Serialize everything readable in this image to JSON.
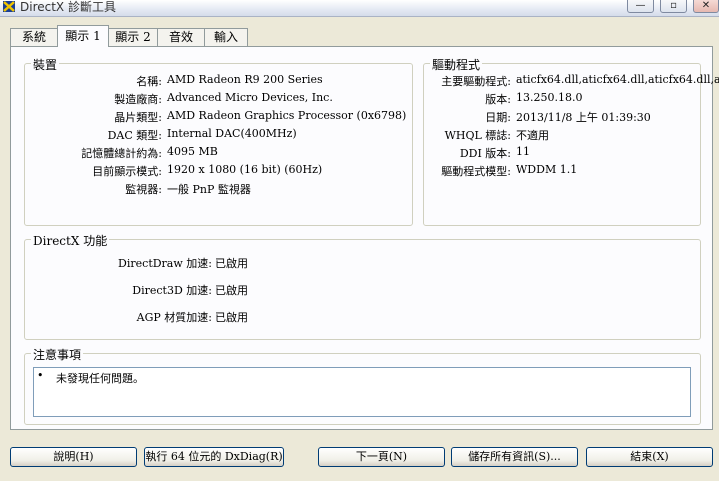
{
  "window": {
    "title": "DirectX 診斷工具",
    "minimize": "—",
    "maximize": "▫",
    "close": "✕"
  },
  "tabs": [
    {
      "label": "系統"
    },
    {
      "label": "顯示 1"
    },
    {
      "label": "顯示 2"
    },
    {
      "label": "音效"
    },
    {
      "label": "輸入"
    }
  ],
  "device": {
    "title": "裝置",
    "rows": [
      {
        "label": "名稱:",
        "value": "AMD Radeon R9 200 Series"
      },
      {
        "label": "製造廠商:",
        "value": "Advanced Micro Devices, Inc."
      },
      {
        "label": "晶片類型:",
        "value": "AMD Radeon Graphics Processor (0x6798)"
      },
      {
        "label": "DAC 類型:",
        "value": "Internal DAC(400MHz)"
      },
      {
        "label": "記憶體總計約為:",
        "value": "4095 MB"
      },
      {
        "label": "目前顯示模式:",
        "value": "1920 x 1080 (16 bit) (60Hz)"
      },
      {
        "label": "監視器:",
        "value": "一般 PnP 監視器"
      }
    ]
  },
  "driver": {
    "title": "驅動程式",
    "rows": [
      {
        "label": "主要驅動程式:",
        "value": "aticfx64.dll,aticfx64.dll,aticfx64.dll,at"
      },
      {
        "label": "版本:",
        "value": "13.250.18.0"
      },
      {
        "label": "日期:",
        "value": "2013/11/8 上午 01:39:30"
      },
      {
        "label": "WHQL 標誌:",
        "value": "不適用"
      },
      {
        "label": "DDI 版本:",
        "value": "11"
      },
      {
        "label": "驅動程式模型:",
        "value": "WDDM 1.1"
      }
    ]
  },
  "features": {
    "title": "DirectX 功能",
    "rows": [
      {
        "label": "DirectDraw 加速:",
        "value": "已啟用"
      },
      {
        "label": "Direct3D 加速:",
        "value": "已啟用"
      },
      {
        "label": "AGP 材質加速:",
        "value": "已啟用"
      }
    ]
  },
  "notes": {
    "title": "注意事項",
    "bullet": "•",
    "items": [
      "未發現任何問題。"
    ]
  },
  "buttons": {
    "help": "說明(H)",
    "run64": "執行 64 位元的 DxDiag(R)",
    "next": "下一頁(N)",
    "save": "儲存所有資訊(S)...",
    "exit": "結束(X)"
  }
}
